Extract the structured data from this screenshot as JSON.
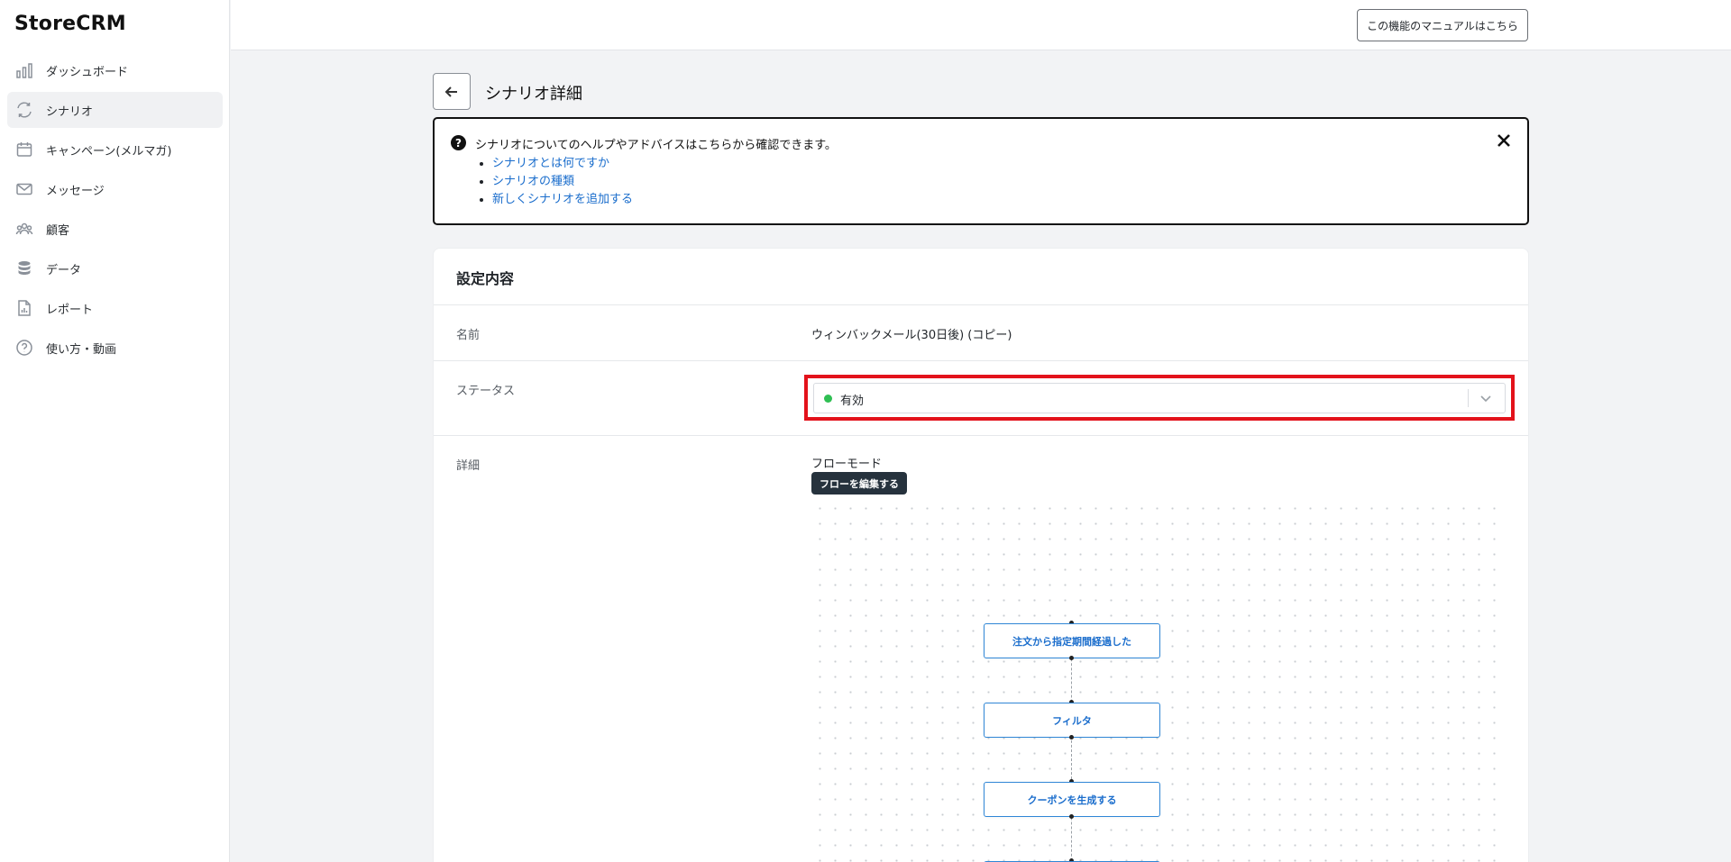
{
  "app": {
    "logo": "StoreCRM"
  },
  "sidebar": {
    "items": [
      {
        "label": "ダッシュボード",
        "icon": "bar-chart-icon",
        "active": false
      },
      {
        "label": "シナリオ",
        "icon": "refresh-icon",
        "active": true
      },
      {
        "label": "キャンペーン(メルマガ)",
        "icon": "calendar-icon",
        "active": false
      },
      {
        "label": "メッセージ",
        "icon": "mail-icon",
        "active": false
      },
      {
        "label": "顧客",
        "icon": "users-icon",
        "active": false
      },
      {
        "label": "データ",
        "icon": "database-icon",
        "active": false
      },
      {
        "label": "レポート",
        "icon": "report-icon",
        "active": false
      },
      {
        "label": "使い方・動画",
        "icon": "help-circle-icon",
        "active": false
      }
    ]
  },
  "topbar": {
    "manual_button": "この機能のマニュアルはこちら"
  },
  "page": {
    "title": "シナリオ詳細"
  },
  "help": {
    "text": "シナリオについてのヘルプやアドバイスはこちらから確認できます。",
    "links": [
      "シナリオとは何ですか",
      "シナリオの種類",
      "新しくシナリオを追加する"
    ]
  },
  "settings": {
    "title": "設定内容",
    "name_label": "名前",
    "name_value": "ウィンバックメール(30日後) (コピー)",
    "status_label": "ステータス",
    "status_value": "有効",
    "status_color": "#2fbf53",
    "detail_label": "詳細",
    "mode": "フローモード",
    "edit_flow_button": "フローを編集する"
  },
  "flow": {
    "nodes": [
      "注文から指定期間経過した",
      "フィルタ",
      "クーポンを生成する"
    ]
  },
  "colors": {
    "accent": "#1a6dcc",
    "highlight": "#e3121b"
  }
}
